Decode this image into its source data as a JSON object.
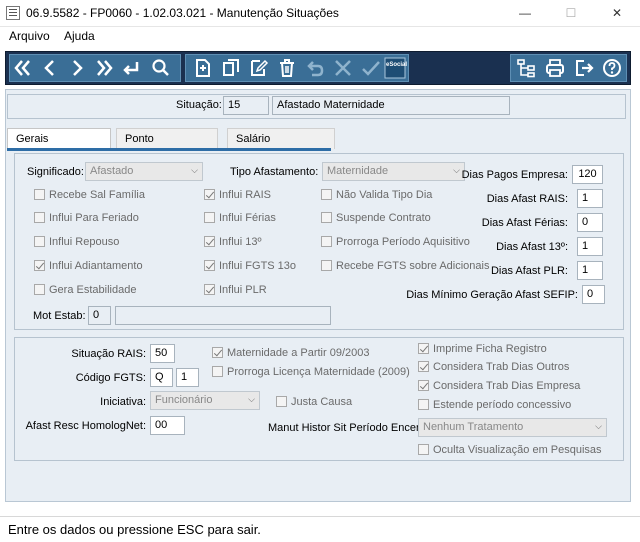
{
  "window": {
    "title": "06.9.5582 - FP0060 - 1.02.03.021 - Manutenção Situações",
    "minimize_glyph": "—",
    "maximize_glyph": "☐",
    "close_glyph": "✕"
  },
  "menu": {
    "items": [
      "Arquivo",
      "Ajuda"
    ]
  },
  "toolbar": {
    "icons": [
      "first-icon",
      "previous-icon",
      "next-icon",
      "last-icon",
      "enter-icon",
      "search-icon",
      "new-icon",
      "copy-icon",
      "edit-icon",
      "delete-icon",
      "undo-icon",
      "cancel-icon",
      "confirm-icon",
      "esocial-icon",
      "tree-icon",
      "print-icon",
      "exit-icon",
      "help-icon"
    ],
    "esocial_label": "eSocial"
  },
  "header": {
    "situacao_label": "Situação:",
    "situacao_code": "15",
    "situacao_desc": "Afastado Maternidade"
  },
  "tabs": [
    "Gerais",
    "Ponto",
    "Salário"
  ],
  "gerais": {
    "significado_label": "Significado:",
    "significado_value": "Afastado",
    "tipo_afastamento_label": "Tipo Afastamento:",
    "tipo_afastamento_value": "Maternidade",
    "dias_pagos_empresa_label": "Dias Pagos Empresa:",
    "dias_pagos_empresa_value": "120",
    "dias_afast_rais_label": "Dias Afast RAIS:",
    "dias_afast_rais_value": "1",
    "dias_afast_ferias_label": "Dias Afast Férias:",
    "dias_afast_ferias_value": "0",
    "dias_afast_13_label": "Dias Afast 13º:",
    "dias_afast_13_value": "1",
    "dias_afast_plr_label": "Dias Afast PLR:",
    "dias_afast_plr_value": "1",
    "dias_minimo_sefip_label": "Dias Mínimo Geração Afast SEFIP:",
    "dias_minimo_sefip_value": "0",
    "mot_estab_label": "Mot Estab:",
    "mot_estab_value": "0",
    "mot_estab_desc": "",
    "checkboxes_col1": [
      {
        "label": "Recebe Sal Família",
        "checked": false
      },
      {
        "label": "Influi Para Feriado",
        "checked": false
      },
      {
        "label": "Influi Repouso",
        "checked": false
      },
      {
        "label": "Influi Adiantamento",
        "checked": true
      },
      {
        "label": "Gera Estabilidade",
        "checked": false
      }
    ],
    "checkboxes_col2": [
      {
        "label": "Influi RAIS",
        "checked": true
      },
      {
        "label": "Influi Férias",
        "checked": false
      },
      {
        "label": "Influi 13º",
        "checked": true
      },
      {
        "label": "Influi FGTS 13o",
        "checked": true
      },
      {
        "label": "Influi PLR",
        "checked": true
      }
    ],
    "checkboxes_col3": [
      {
        "label": "Não Valida Tipo Dia",
        "checked": false
      },
      {
        "label": "Suspende Contrato",
        "checked": false
      },
      {
        "label": "Prorroga Período Aquisitivo",
        "checked": false
      },
      {
        "label": "Recebe FGTS sobre Adicionais",
        "checked": false
      }
    ]
  },
  "lower": {
    "situacao_rais_label": "Situação RAIS:",
    "situacao_rais_value": "50",
    "codigo_fgts_label": "Código FGTS:",
    "codigo_fgts_letter": "Q",
    "codigo_fgts_number": "1",
    "iniciativa_label": "Iniciativa:",
    "iniciativa_value": "Funcionário",
    "afast_resc_label": "Afast Resc HomologNet:",
    "afast_resc_value": "00",
    "manut_histor_label": "Manut Histor Sit Período Encer:",
    "manut_histor_value": "Nenhum Tratamento",
    "cb_maternidade": {
      "label": "Maternidade a Partir 09/2003",
      "checked": true
    },
    "cb_prorroga_licenca": {
      "label": "Prorroga Licença Maternidade (2009)",
      "checked": false
    },
    "cb_justa_causa": {
      "label": "Justa Causa",
      "checked": false
    },
    "cb_imprime_ficha": {
      "label": "Imprime Ficha Registro",
      "checked": true
    },
    "cb_considera_outros": {
      "label": "Considera Trab Dias Outros",
      "checked": true
    },
    "cb_considera_empresa": {
      "label": "Considera Trab Dias Empresa",
      "checked": true
    },
    "cb_estende_periodo": {
      "label": "Estende período concessivo",
      "checked": false
    },
    "cb_oculta_visualizacao": {
      "label": "Oculta Visualização em Pesquisas",
      "checked": false
    }
  },
  "status": {
    "text": "Entre os dados ou pressione ESC para sair."
  },
  "colors": {
    "toolbar_bg": "#1a3050",
    "toolbar_group": "#3a6e96",
    "panel_bg": "#e8eef4",
    "tab_accent": "#2e6da6"
  }
}
